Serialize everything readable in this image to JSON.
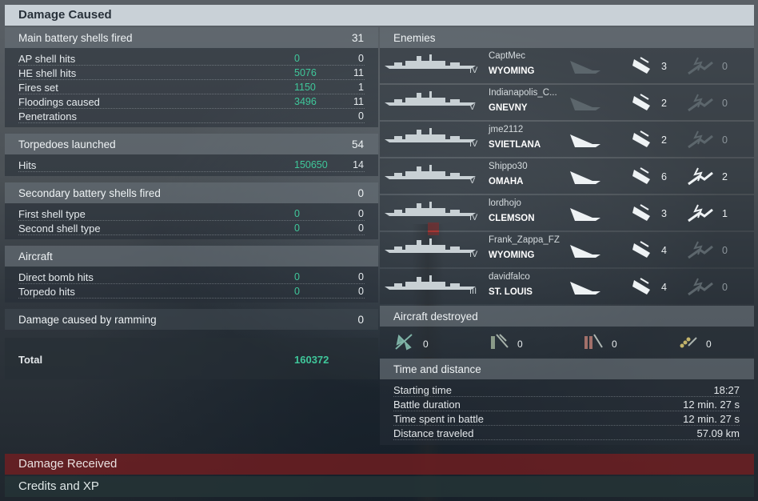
{
  "header": {
    "title": "Damage Caused"
  },
  "main_battery": {
    "title": "Main battery shells fired",
    "value": "31",
    "rows": [
      {
        "label": "AP shell hits",
        "damage": "0",
        "count": "0"
      },
      {
        "label": "HE shell hits",
        "damage": "5076",
        "count": "11"
      },
      {
        "label": "Fires set",
        "damage": "1150",
        "count": "1"
      },
      {
        "label": "Floodings caused",
        "damage": "3496",
        "count": "11"
      },
      {
        "label": "Penetrations",
        "damage": "",
        "count": "0"
      }
    ]
  },
  "torpedoes": {
    "title": "Torpedoes launched",
    "value": "54",
    "rows": [
      {
        "label": "Hits",
        "damage": "150650",
        "count": "14"
      }
    ]
  },
  "secondary": {
    "title": "Secondary battery shells fired",
    "value": "0",
    "rows": [
      {
        "label": "First shell type",
        "damage": "0",
        "count": "0"
      },
      {
        "label": "Second shell type",
        "damage": "0",
        "count": "0"
      }
    ]
  },
  "aircraft": {
    "title": "Aircraft",
    "rows": [
      {
        "label": "Direct bomb hits",
        "damage": "0",
        "count": "0"
      },
      {
        "label": "Torpedo hits",
        "damage": "0",
        "count": "0"
      }
    ]
  },
  "ramming": {
    "title": "Damage caused by ramming",
    "value": "0"
  },
  "total": {
    "label": "Total",
    "damage": "160372"
  },
  "enemies": {
    "title": "Enemies",
    "list": [
      {
        "player": "CaptMec",
        "ship": "WYOMING",
        "tier": "IV",
        "hits": "3",
        "kills": "0",
        "kill_active": false
      },
      {
        "player": "Indianapolis_C...",
        "ship": "GNEVNY",
        "tier": "V",
        "hits": "2",
        "kills": "0",
        "kill_active": false
      },
      {
        "player": "jme2112",
        "ship": "SVIETLANA",
        "tier": "IV",
        "hits": "2",
        "kills": "0",
        "kill_active": false
      },
      {
        "player": "Shippo30",
        "ship": "OMAHA",
        "tier": "V",
        "hits": "6",
        "kills": "2",
        "kill_active": true
      },
      {
        "player": "lordhojo",
        "ship": "CLEMSON",
        "tier": "IV",
        "hits": "3",
        "kills": "1",
        "kill_active": true
      },
      {
        "player": "Frank_Zappa_FZ",
        "ship": "WYOMING",
        "tier": "IV",
        "hits": "4",
        "kills": "0",
        "kill_active": false
      },
      {
        "player": "davidfalco",
        "ship": "ST. LOUIS",
        "tier": "III",
        "hits": "4",
        "kills": "0",
        "kill_active": false
      }
    ]
  },
  "aircraft_destroyed": {
    "title": "Aircraft destroyed",
    "items": [
      {
        "icon": "fighter-icon",
        "value": "0"
      },
      {
        "icon": "torpedo-bomber-icon",
        "value": "0"
      },
      {
        "icon": "dive-bomber-icon",
        "value": "0"
      },
      {
        "icon": "scout-plane-icon",
        "value": "0"
      }
    ]
  },
  "time_distance": {
    "title": "Time and distance",
    "rows": [
      {
        "label": "Starting time",
        "value": "18:27"
      },
      {
        "label": "Battle duration",
        "value": "12 min. 27 s"
      },
      {
        "label": "Time spent in battle",
        "value": "12 min. 27 s"
      },
      {
        "label": "Distance traveled",
        "value": "57.09 km"
      }
    ]
  },
  "bottom_tabs": {
    "damage_received": "Damage Received",
    "credits_xp": "Credits and XP"
  },
  "colors": {
    "damage_green": "#3fc79a",
    "header_bg": "#c9d1d7",
    "received_red": "#781e20"
  }
}
